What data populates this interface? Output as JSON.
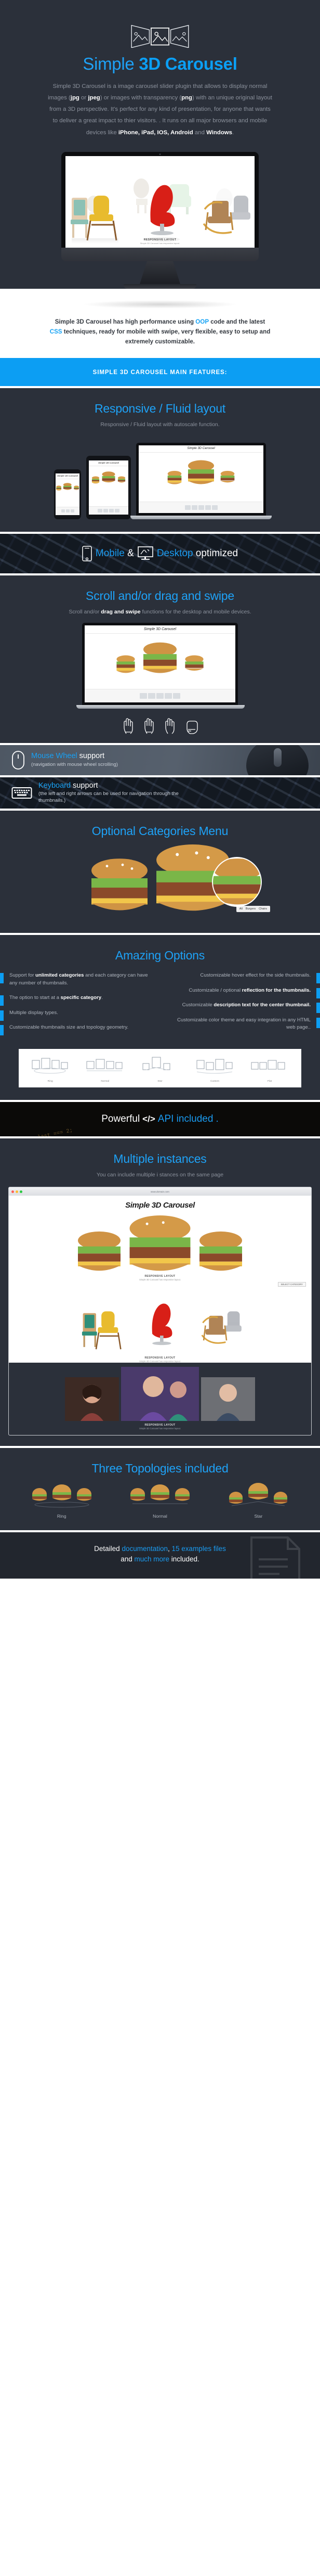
{
  "hero": {
    "logo_icon": "triptych-image-icon",
    "title_light": "Simple ",
    "title_bold": "3D Carousel",
    "paragraph_1": "Simple 3D Carousel is a image carousel slider plugin that allows to display normal images (",
    "bold_jpg": "jpg",
    "paragraph_2": " or ",
    "bold_jpeg": "jpeg",
    "paragraph_3": ") or images with transparency (",
    "bold_png": "png",
    "paragraph_4": ") with an unique original layout from a 3D perspective. It's perfect for any kind of presentation, for anyone that wants to deliver a great impact to thier visitors. . It runs on all major browsers and mobile devices like ",
    "bold_devices": "iPhone, iPad, IOS, Android",
    "paragraph_5": " and ",
    "bold_windows": "Windows",
    "paragraph_6": "."
  },
  "imac": {
    "caption_title": "RESPONSIVE LAYOUT",
    "caption_sub": "Simple 3D Carousel has responsive layout."
  },
  "intro": {
    "text_1": "Simple 3D Carousel has high performance using ",
    "highlight_1": "OOP",
    "text_2": " code and the latest ",
    "highlight_2": "CSS",
    "text_3": " techniques, ready for mobile with swipe, very flexible, easy to setup and extremely customizable."
  },
  "features_bar": {
    "label": "SIMPLE 3D CAROUSEL MAIN FEATURES:"
  },
  "responsive": {
    "title": "Responsive / Fluid layout",
    "subtitle": "Responsive / Fluid layout with autoscale function.",
    "mini_logo": "Simple 3D Carousel"
  },
  "optimized_band": {
    "phone_icon": "mobile-phone-icon",
    "mobile_word": "Mobile",
    "amp": " & ",
    "desktop_icon": "desktop-monitor-icon",
    "desktop_word": "Desktop",
    "optimized_word": " optimized"
  },
  "scroll": {
    "title": "Scroll and/or drag and swipe",
    "sub_1": "Scroll and/or ",
    "sub_bold": "drag and swipe",
    "sub_2": " functions for the desktop and mobile devices.",
    "mini_logo": "Simple 3D Carousel",
    "hand_icons": [
      "hand-swipe-left-icon",
      "hand-swipe-right-icon",
      "hand-drag-icon",
      "hand-grab-icon"
    ]
  },
  "mouse_support": {
    "icon": "computer-mouse-icon",
    "title_blue": "Mouse Wheel",
    "title_rest": " support",
    "sub": "(navigation with mouse wheel scrolling)"
  },
  "keyboard_support": {
    "icon": "keyboard-icon",
    "title_blue": "Keyboard",
    "title_rest": " support",
    "sub": "(the left and right arrows can be used for navigation through the thumbnails.)"
  },
  "categories": {
    "title": "Optional Categories Menu",
    "menu_items": [
      "All",
      "Burgers",
      "Chairs"
    ]
  },
  "options": {
    "title": "Amazing Options",
    "left": [
      {
        "pre": "Support for ",
        "bold": "unlimited categories",
        "post": " and each category can have any number of thumbnails."
      },
      {
        "pre": "The option to start at a ",
        "bold": "specific category",
        "post": "."
      },
      {
        "pre": "Multiple display types.",
        "bold": "",
        "post": ""
      },
      {
        "pre": "Customizable thumbnails size and topology geometry.",
        "bold": "",
        "post": ""
      }
    ],
    "right": [
      {
        "pre": "Customizable hover effect for the side thumbnails.",
        "bold": "",
        "post": ""
      },
      {
        "pre": "Customizable / optional ",
        "bold": "reflection for the thumbnails.",
        "post": ""
      },
      {
        "pre": "Customizable ",
        "bold": "description text for the center thumbnail.",
        "post": ""
      },
      {
        "pre": "Customizable color theme and easy integration in any HTML web page..",
        "bold": "",
        "post": ""
      }
    ],
    "diagram_labels": [
      "Ring",
      "Normal",
      "Star",
      "Custom",
      "Flat"
    ]
  },
  "api": {
    "word_1": "Powerful",
    "code_icon": "</>",
    "word_2": "API included",
    "word_3": "."
  },
  "instances": {
    "title": "Multiple instances",
    "subtitle": "You can include multiple i stances on the same page",
    "browser_url": "www.domain.com",
    "brand": "Simple 3D Carousel",
    "caption_1": "RESPONSIVE LAYOUT",
    "caption_1_sub": "Simple 3D Carousel has responsive layout.",
    "caption_2": "RESPONSIVE LAYOUT",
    "caption_2_sub": "Simple 3D Carousel has responsive layout.",
    "caption_3": "RESPONSIVE LAYOUT",
    "caption_3_sub": "Simple 3D Carousel has responsive layout.",
    "select_label": "SELECT CATEGORY"
  },
  "topologies": {
    "title": "Three Topologies included",
    "items": [
      "Ring",
      "Normal",
      "Star"
    ]
  },
  "footer": {
    "text_1": "Detailed ",
    "blue_1": "documentation",
    "text_2": ", ",
    "blue_2": "15 examples files",
    "text_3": " and ",
    "blue_3": "much more",
    "text_4": " included.",
    "icon": "document-icon"
  },
  "colors": {
    "accent": "#0c9ef3",
    "accent_light": "#1ea2f7",
    "dark_bg": "#2b303a",
    "muted_text": "#8b919c"
  }
}
